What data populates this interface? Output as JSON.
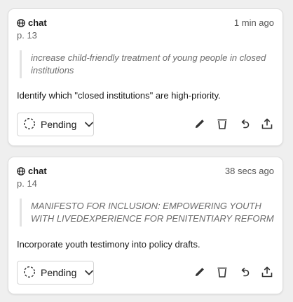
{
  "cards": [
    {
      "source": "chat",
      "time": "1 min ago",
      "page": "p. 13",
      "quote": "increase child-friendly treatment of young people in closed institutions",
      "note": "Identify which \"closed institutions\" are high-priority.",
      "status": "Pending"
    },
    {
      "source": "chat",
      "time": "38 secs ago",
      "page": "p. 14",
      "quote": "MANIFESTO FOR INCLUSION: EMPOWERING YOUTH WITH LIVEDEXPERIENCE FOR PENITENTIARY REFORM",
      "note": "Incorporate youth testimony into policy drafts.",
      "status": "Pending"
    }
  ],
  "icons": {
    "source": "globe-icon",
    "status": "dashed-circle-icon",
    "dropdown": "chevron-down-icon",
    "edit": "pencil-icon",
    "delete": "trash-icon",
    "undo": "undo-icon",
    "share": "share-icon"
  },
  "colors": {
    "background": "#efefef",
    "card": "#ffffff",
    "quote_text": "#6b6b6b",
    "icon": "#333333"
  }
}
